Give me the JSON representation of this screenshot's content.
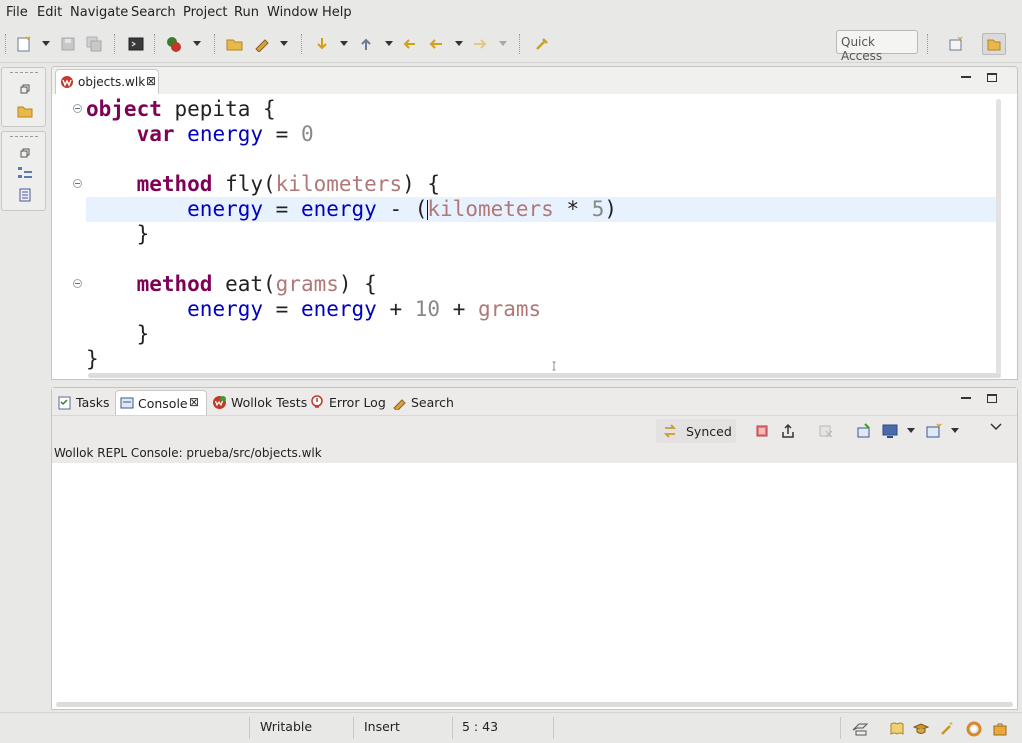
{
  "menu": [
    "File",
    "Edit",
    "Navigate",
    "Search",
    "Project",
    "Run",
    "Window",
    "Help"
  ],
  "toolbar": {
    "quick_access": "Quick Access"
  },
  "editor": {
    "tab_label": "objects.wlk",
    "code": {
      "l1": {
        "kw": "object",
        "rest": " pepita {"
      },
      "l2": {
        "kw": "var",
        "field": "energy",
        "rest": " = ",
        "num": "0"
      },
      "l4": {
        "kw": "method",
        "name": " fly(",
        "param": "kilometers",
        "rest": ") {"
      },
      "l5": {
        "field1": "energy",
        "op1": " = ",
        "field2": "energy",
        "op2": " - (",
        "param": "kilometers",
        "op3": " * ",
        "num": "5",
        "close": ")"
      },
      "l6": "}",
      "l8": {
        "kw": "method",
        "name": " eat(",
        "param": "grams",
        "rest": ") {"
      },
      "l9": {
        "field1": "energy",
        "op1": " = ",
        "field2": "energy",
        "op2": " + ",
        "num": "10",
        "op3": " + ",
        "param": "grams"
      },
      "l10": "}",
      "l11": "}"
    }
  },
  "console": {
    "tabs": [
      "Tasks",
      "Console",
      "Wollok Tests",
      "Error Log",
      "Search"
    ],
    "synced_label": "Synced",
    "title": "Wollok REPL Console: prueba/src/objects.wlk"
  },
  "status": {
    "writable": "Writable",
    "insert": "Insert",
    "position": "5 : 43"
  },
  "colors": {
    "keyword": "#7f0055",
    "field": "#0000c0",
    "number": "#888888",
    "parameter": "#b07878",
    "current_line": "#e8f2fe"
  }
}
